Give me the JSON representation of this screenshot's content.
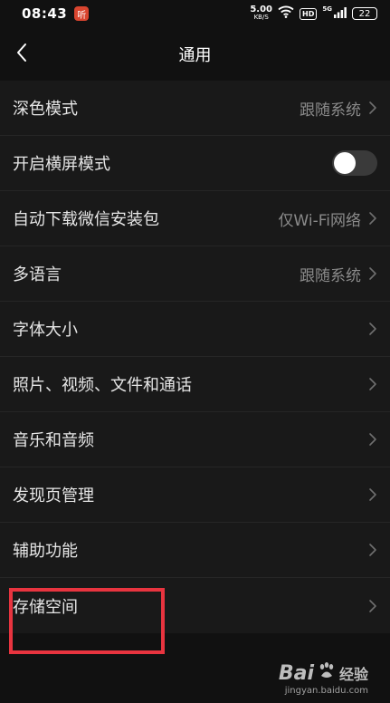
{
  "status_bar": {
    "time": "08:43",
    "app_badge": "听",
    "net_speed_value": "5.00",
    "net_speed_unit": "KB/S",
    "hd": "HD",
    "signal_label": "5G",
    "battery": "22"
  },
  "nav": {
    "title": "通用"
  },
  "settings": {
    "items": [
      {
        "label": "深色模式",
        "value": "跟随系统"
      },
      {
        "label": "开启横屏模式",
        "toggle_on": false
      },
      {
        "label": "自动下载微信安装包",
        "value": "仅Wi-Fi网络"
      },
      {
        "label": "多语言",
        "value": "跟随系统"
      },
      {
        "label": "字体大小"
      },
      {
        "label": "照片、视频、文件和通话"
      },
      {
        "label": "音乐和音频"
      },
      {
        "label": "发现页管理"
      },
      {
        "label": "辅助功能"
      },
      {
        "label": "存储空间"
      }
    ]
  },
  "watermark": {
    "brand": "Bai",
    "brand_suffix": "经验",
    "url": "jingyan.baidu.com"
  },
  "colors": {
    "highlight": "#e8343f",
    "background": "#111111",
    "row_background": "#191919"
  }
}
